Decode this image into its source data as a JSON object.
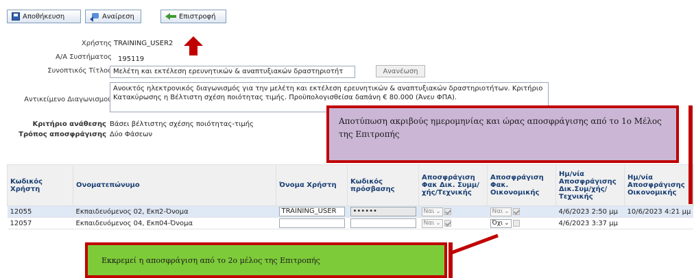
{
  "toolbar": {
    "save_label": "Αποθήκευση",
    "undo_label": "Αναίρεση",
    "back_label": "Επιστροφή"
  },
  "form": {
    "user_label": "Χρήστης",
    "user_value": "TRAINING_USER2",
    "system_id_label": "Α/Α Συστήματος",
    "system_id_value": "195119",
    "short_title_label": "Συνοπτικός Τίτλος",
    "short_title_value": "Μελέτη και εκτέλεση ερευνητικών & αναπτυξιακών δραστηριοτήτ",
    "refresh_label": "Ανανέωση",
    "subject_label": "Αντικείμενο Διαγωνισμού",
    "subject_value": "Ανοικτός ηλεκτρονικός διαγωνισμός για την  μελέτη και εκτέλεση ερευνητικών & αναπτυξιακών δραστηριοτήτων. Κριτήριο Κατακύρωσης η Βέλτιστη σχέση ποιότητας τιμής. Προϋπολογισθείσα δαπάνη € 80.000 (Άνευ ΦΠΑ).",
    "award_criterion_label": "Κριτήριο ανάθεσης",
    "award_criterion_value": "Βάσει βέλτιστης σχέσης ποιότητας-τιμής",
    "unsealing_method_label": "Τρόπος αποσφράγισης",
    "unsealing_method_value": "Δύο Φάσεων"
  },
  "callouts": {
    "purple_text": "Αποτύπωση ακριβούς ημερομηνίας και ώρας αποσφράγισης από το 1ο Μέλος της Επιτροπής",
    "green_text": "Εκκρεμεί η αποσφράγιση από το 2ο μέλος της Επιτροπής"
  },
  "table": {
    "headers": [
      "Κωδικός Χρήστη",
      "Ονοματεπώνυμο",
      "Όνομα Χρήστη",
      "Κωδικός πρόσβασης",
      "Αποσφράγιση Φακ Δικ. Συμμ/ χής/Τεχνικής",
      "Αποσφράγιση Φακ. Οικονομικής",
      "Ημ/νία Αποσφράγισης Δικ.Συμ/χής/ Τεχνικής",
      "Ημ/νία Αποσφράγισης Οικονομικής"
    ],
    "rows": [
      {
        "code": "12055",
        "name": "Εκπαιδευόμενος 02, Εκπ2-Όνομα",
        "username": "TRAINING_USER",
        "password": "••••••",
        "tech_unseal": "Ναι",
        "fin_unseal": "Ναι",
        "tech_date": "4/6/2023 2:50 μμ",
        "fin_date": "10/6/2023 4:21 μμ"
      },
      {
        "code": "12057",
        "name": "Εκπαιδευόμενος 04, Εκπ04-Όνομα",
        "username": "",
        "password": "",
        "tech_unseal": "Ναι",
        "fin_unseal": "Όχι",
        "tech_date": "4/6/2023 3:37 μμ",
        "fin_date": ""
      }
    ]
  },
  "colors": {
    "callout_border": "#c00000",
    "callout_purple": "#cbb6d6",
    "callout_green": "#7ecb3a",
    "header_text": "#1a3f73",
    "selected_row": "#dfe8f5"
  }
}
